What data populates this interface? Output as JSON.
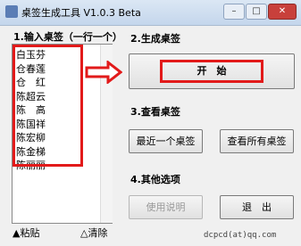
{
  "window": {
    "title": "桌签生成工具 V1.0.3 Beta",
    "min_label": "–",
    "max_label": "□",
    "close_label": "✕"
  },
  "step1": {
    "label": "1.输入桌签（一行一个）",
    "names": [
      "白玉芬",
      "仓春莲",
      "仓　红",
      "陈超云",
      "陈　高",
      "陈国祥",
      "陈宏柳",
      "陈金梯",
      "陈丽丽"
    ]
  },
  "step2": {
    "label": "2.生成桌签",
    "start_button": "开　始"
  },
  "step3": {
    "label": "3.查看桌签",
    "recent_button": "最近一个桌签",
    "all_button": "查看所有桌签"
  },
  "step4": {
    "label": "4.其他选项",
    "help_button": "使用说明",
    "exit_button": "退　出"
  },
  "bottom": {
    "paste_label": "▲粘贴",
    "clear_label": "△清除"
  },
  "footer": {
    "contact": "dcpcd(at)qq.com"
  },
  "colors": {
    "highlight": "#e21a1a",
    "title_bar": "#c4d6ec"
  }
}
